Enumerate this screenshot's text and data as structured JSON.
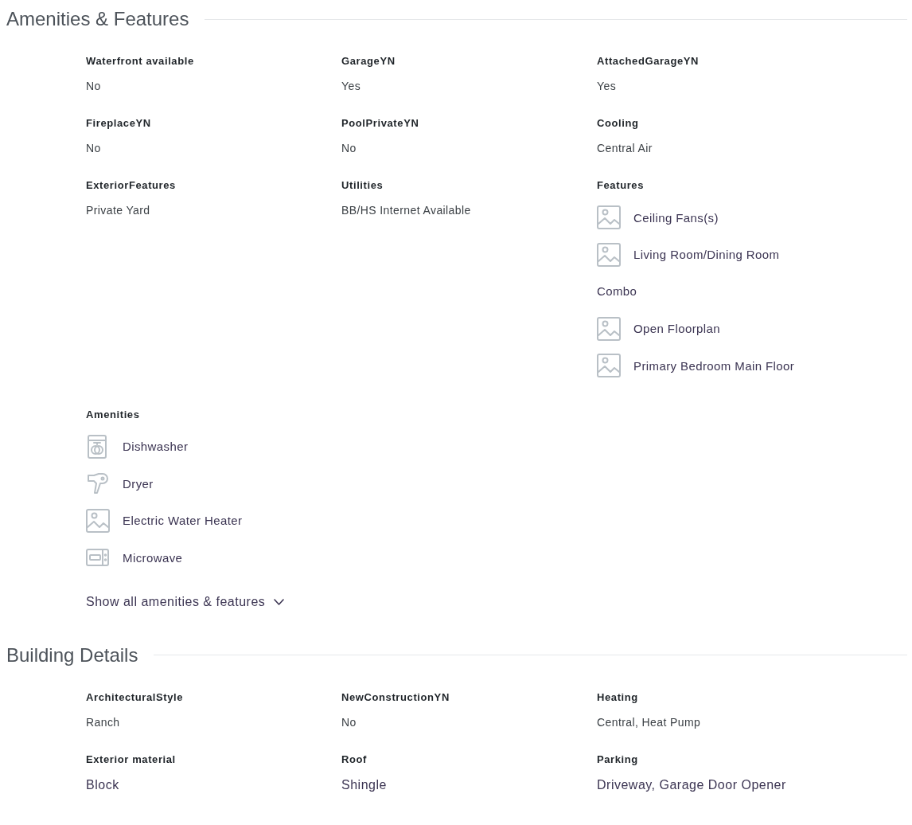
{
  "sections": [
    {
      "title": "Amenities & Features",
      "fields": [
        {
          "kind": "plain",
          "label": "Waterfront available",
          "value": "No"
        },
        {
          "kind": "plain",
          "label": "GarageYN",
          "value": "Yes"
        },
        {
          "kind": "plain",
          "label": "AttachedGarageYN",
          "value": "Yes"
        },
        {
          "kind": "plain",
          "label": "FireplaceYN",
          "value": "No"
        },
        {
          "kind": "plain",
          "label": "PoolPrivateYN",
          "value": "No"
        },
        {
          "kind": "plain",
          "label": "Cooling",
          "value": "Central Air"
        },
        {
          "kind": "plain",
          "label": "ExteriorFeatures",
          "value": "Private Yard"
        },
        {
          "kind": "plain",
          "label": "Utilities",
          "value": "BB/HS Internet Available"
        },
        {
          "kind": "icons",
          "label": "Features",
          "items": [
            {
              "kind": "picture",
              "lines": [
                "Ceiling Fans(s)"
              ]
            },
            {
              "kind": "picture",
              "lines": [
                "Living Room/Dining Room",
                "Combo"
              ]
            },
            {
              "kind": "picture",
              "lines": [
                "Open Floorplan"
              ]
            },
            {
              "kind": "picture",
              "lines": [
                "Primary Bedroom Main Floor"
              ]
            }
          ]
        },
        {
          "kind": "icons",
          "label": "Amenities",
          "items": [
            {
              "kind": "dishwasher",
              "lines": [
                "Dishwasher"
              ]
            },
            {
              "kind": "dryer",
              "lines": [
                "Dryer"
              ]
            },
            {
              "kind": "picture",
              "lines": [
                "Electric Water Heater"
              ]
            },
            {
              "kind": "microwave",
              "lines": [
                "Microwave"
              ]
            }
          ]
        }
      ],
      "show_all": "Show all amenities & features"
    },
    {
      "title": "Building Details",
      "fields": [
        {
          "kind": "plain",
          "label": "ArchitecturalStyle",
          "value": "Ranch"
        },
        {
          "kind": "plain",
          "label": "NewConstructionYN",
          "value": "No"
        },
        {
          "kind": "plain",
          "label": "Heating",
          "value": "Central, Heat Pump"
        },
        {
          "kind": "large",
          "label": "Exterior material",
          "value": "Block"
        },
        {
          "kind": "large",
          "label": "Roof",
          "value": "Shingle"
        },
        {
          "kind": "large",
          "label": "Parking",
          "value": "Driveway, Garage Door Opener"
        }
      ]
    }
  ]
}
